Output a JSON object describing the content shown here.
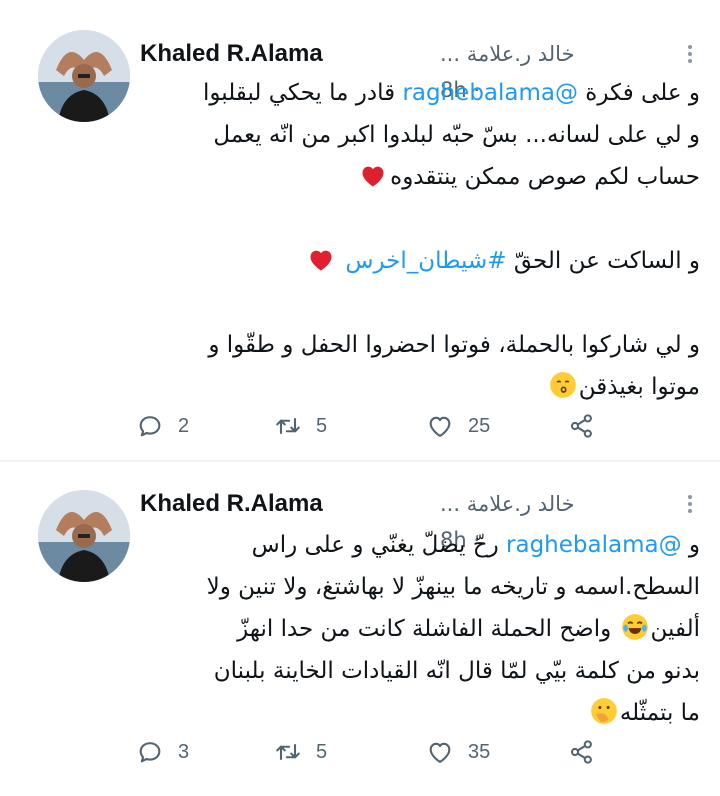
{
  "tweets": [
    {
      "author_name": "Khaled R.Alama",
      "handle_line": "خالد ر.علامة ... · 8h",
      "lines": [
        {
          "parts": [
            {
              "t": "و على فكرة "
            },
            {
              "t": "@raghebalama",
              "link": true
            },
            {
              "t": " قادر ما يحكي لبقلبوا"
            }
          ]
        },
        {
          "parts": [
            {
              "t": "و لي على لسانه... بسّ حبّه لبلدوا اكبر من انّه يعمل"
            }
          ]
        },
        {
          "parts": [
            {
              "t": "حساب لكم صوص ممكن ينتقدوه"
            },
            {
              "emoji": "red-heart"
            }
          ]
        },
        {
          "blank": true
        },
        {
          "parts": [
            {
              "t": "و الساكت عن الحقّ "
            },
            {
              "t": "#شيطان_اخرس",
              "link": true
            },
            {
              "t": " "
            },
            {
              "emoji": "red-heart"
            }
          ]
        },
        {
          "blank": true
        },
        {
          "parts": [
            {
              "t": "و لي شاركوا بالحملة، فوتوا احضروا الحفل و طقّوا و"
            }
          ]
        },
        {
          "parts": [
            {
              "t": "موتوا بغيذقن"
            },
            {
              "emoji": "kissing-face"
            }
          ]
        }
      ],
      "replies": "2",
      "retweets": "5",
      "likes": "25"
    },
    {
      "author_name": "Khaled R.Alama",
      "handle_line": "خالد ر.علامة ... · 8h",
      "lines": [
        {
          "parts": [
            {
              "t": "و "
            },
            {
              "t": "@raghebalama",
              "link": true
            },
            {
              "t": " رحّ يضلّ يغنّي و على راس"
            }
          ]
        },
        {
          "parts": [
            {
              "t": "السطح.اسمه و تاريخه ما بينهزّ لا بهاشتغ، ولا تنين ولا"
            }
          ]
        },
        {
          "parts": [
            {
              "t": "ألفين"
            },
            {
              "emoji": "tears-of-joy-face"
            },
            {
              "t": " واضح الحملة الفاشلة كانت من حدا انهزّ"
            }
          ]
        },
        {
          "parts": [
            {
              "t": "بدنو من كلمة بيّي لمّا قال انّه القيادات الخاينة بلبنان"
            }
          ]
        },
        {
          "parts": [
            {
              "t": "ما بتمثّله"
            },
            {
              "emoji": "hand-over-mouth-face"
            }
          ]
        }
      ],
      "replies": "3",
      "retweets": "5",
      "likes": "35"
    }
  ],
  "colors": {
    "link": "#1d9bf0",
    "secondary": "#536471",
    "heart": "#f4212e"
  }
}
